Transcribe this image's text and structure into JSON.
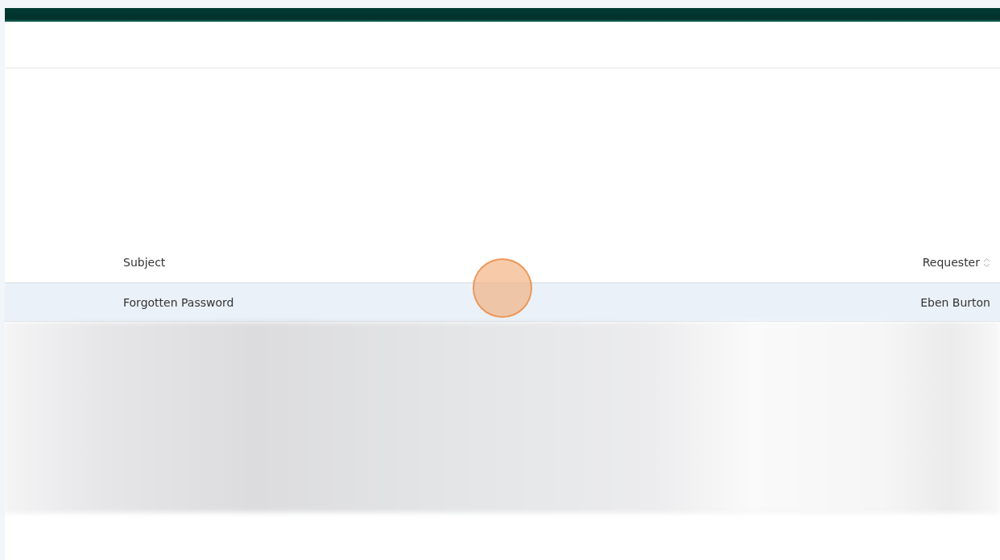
{
  "table": {
    "columns": [
      {
        "label": "Subject",
        "sortable": false
      },
      {
        "label": "Requester",
        "sortable": true
      }
    ],
    "rows": [
      {
        "subject": "Forgotten Password",
        "requester": "Eben Burton",
        "selected": true
      }
    ]
  },
  "click_marker": {
    "shown": true
  }
}
